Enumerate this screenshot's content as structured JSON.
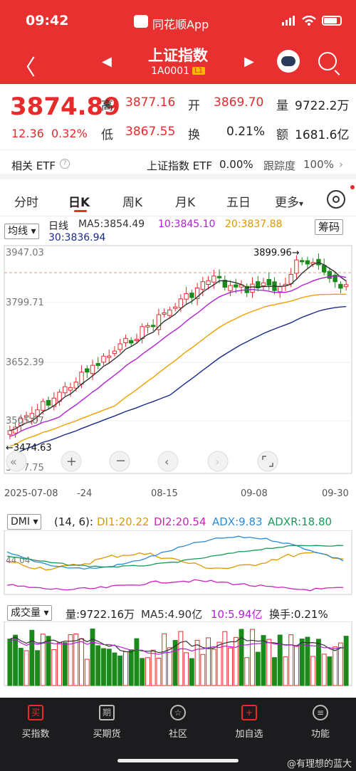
{
  "status": {
    "time": "09:42",
    "app": "同花顺App"
  },
  "header": {
    "back": "〈",
    "prev": "◀",
    "next": "▶",
    "title": "上证指数",
    "code": "1A0001",
    "level": "L1"
  },
  "quote": {
    "price": "3874.89",
    "change": "12.36",
    "change_pct": "0.32%",
    "high_label": "高",
    "high": "3877.16",
    "open_label": "开",
    "open": "3869.70",
    "vol_label": "量",
    "vol": "9722.2万",
    "low_label": "低",
    "low": "3867.55",
    "turnover_label": "换",
    "turnover": "0.21%",
    "amount_label": "额",
    "amount": "1681.6亿"
  },
  "etf": {
    "label": "相关 ETF",
    "name": "上证指数 ETF",
    "pct": "0.00%",
    "track_label": "跟踪度",
    "track": "100%"
  },
  "tabs": [
    "分时",
    "日K",
    "周K",
    "月K",
    "五日",
    "更多"
  ],
  "tabs_more_caret": "▾",
  "kline": {
    "ma_select": "均线",
    "period": "日线",
    "ma5": "MA5:3854.49",
    "ma10": "10:3845.10",
    "ma20": "20:3837.88",
    "ma30": "30:3836.94",
    "chip_btn": "筹码",
    "y_top": "3947.03",
    "y_2": "3799.71",
    "y_3": "3652.39",
    "y_4": "3505.07",
    "y_bottom": "3357.75",
    "hi_mark": "3899.96→",
    "lo_mark": "←3474.63",
    "dates": [
      "2025-07-08",
      "-24",
      "08-15",
      "09-08",
      "09-30"
    ]
  },
  "dmi": {
    "select": "DMI",
    "params": "(14, 6):",
    "di1": "DI1:20.22",
    "di2": "DI2:20.54",
    "adx": "ADX:9.83",
    "adxr": "ADXR:18.80",
    "y": "44.04"
  },
  "volume": {
    "select": "成交量",
    "vol": "量:9722.16万",
    "ma5": "MA5:4.90亿",
    "ma10": "10:5.94亿",
    "turnover": "换手:0.21%"
  },
  "colors": {
    "red": "#e62b2b",
    "green": "#1a8a1a",
    "ma5": "#333333",
    "ma10": "#b31fd6",
    "ma20": "#f0a000",
    "ma30": "#1a2a8a"
  },
  "nav": [
    {
      "label": "买指数",
      "icon": "买"
    },
    {
      "label": "买期货",
      "icon": "期"
    },
    {
      "label": "社区",
      "icon": "☆"
    },
    {
      "label": "加自选",
      "icon": "+"
    },
    {
      "label": "功能",
      "icon": "≡"
    }
  ],
  "watermark": "@有理想的蓝大"
}
